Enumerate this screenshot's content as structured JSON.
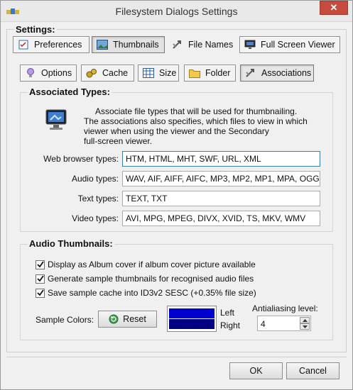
{
  "window": {
    "title": "Filesystem Dialogs Settings",
    "close_glyph": "✕"
  },
  "settings_label": "Settings:",
  "main_tabs": [
    {
      "label": "Preferences",
      "icon": "preferences-icon",
      "active": false
    },
    {
      "label": "Thumbnails",
      "icon": "thumbnails-icon",
      "active": true
    },
    {
      "label": "File Names",
      "icon": "file-names-icon",
      "active": false
    },
    {
      "label": "Full Screen Viewer",
      "icon": "monitor-icon",
      "active": false
    }
  ],
  "sub_tabs": [
    {
      "label": "Options",
      "icon": "bulb-icon",
      "active": false
    },
    {
      "label": "Cache",
      "icon": "cache-icon",
      "active": false
    },
    {
      "label": "Size",
      "icon": "size-icon",
      "active": false
    },
    {
      "label": "Folder",
      "icon": "folder-icon",
      "active": false
    },
    {
      "label": "Associations",
      "icon": "associations-icon",
      "active": true
    }
  ],
  "associated": {
    "title": "Associated Types:",
    "description": [
      "Associate file types that will be used for thumbnailing.",
      "The associations also specifies, which files to view in which",
      "viewer when using the viewer and the Secondary",
      "full-screen viewer."
    ],
    "fields": [
      {
        "label": "Web browser types:",
        "value": "HTM, HTML, MHT, SWF, URL, XML"
      },
      {
        "label": "Audio types:",
        "value": "WAV, AIF, AIFF, AIFC, MP3, MP2, MP1, MPA, OGG"
      },
      {
        "label": "Text types:",
        "value": "TEXT, TXT"
      },
      {
        "label": "Video types:",
        "value": "AVI, MPG, MPEG, DIVX, XVID, TS, MKV, WMV"
      }
    ]
  },
  "audio": {
    "title": "Audio Thumbnails:",
    "checkboxes": [
      {
        "label": "Display as Album cover if album cover picture available",
        "checked": true
      },
      {
        "label": "Generate sample thumbnails for recognised audio files",
        "checked": true
      },
      {
        "label": "Save sample cache into ID3v2 SESC (+0.35% file size)",
        "checked": true
      }
    ],
    "sample_colors_label": "Sample Colors:",
    "reset_label": "Reset",
    "left_label": "Left",
    "right_label": "Right",
    "left_color": "#0000cc",
    "right_color": "#000080",
    "antialiasing_label": "Antialiasing level:",
    "antialiasing_value": "4"
  },
  "buttons": {
    "ok": "OK",
    "cancel": "Cancel"
  }
}
